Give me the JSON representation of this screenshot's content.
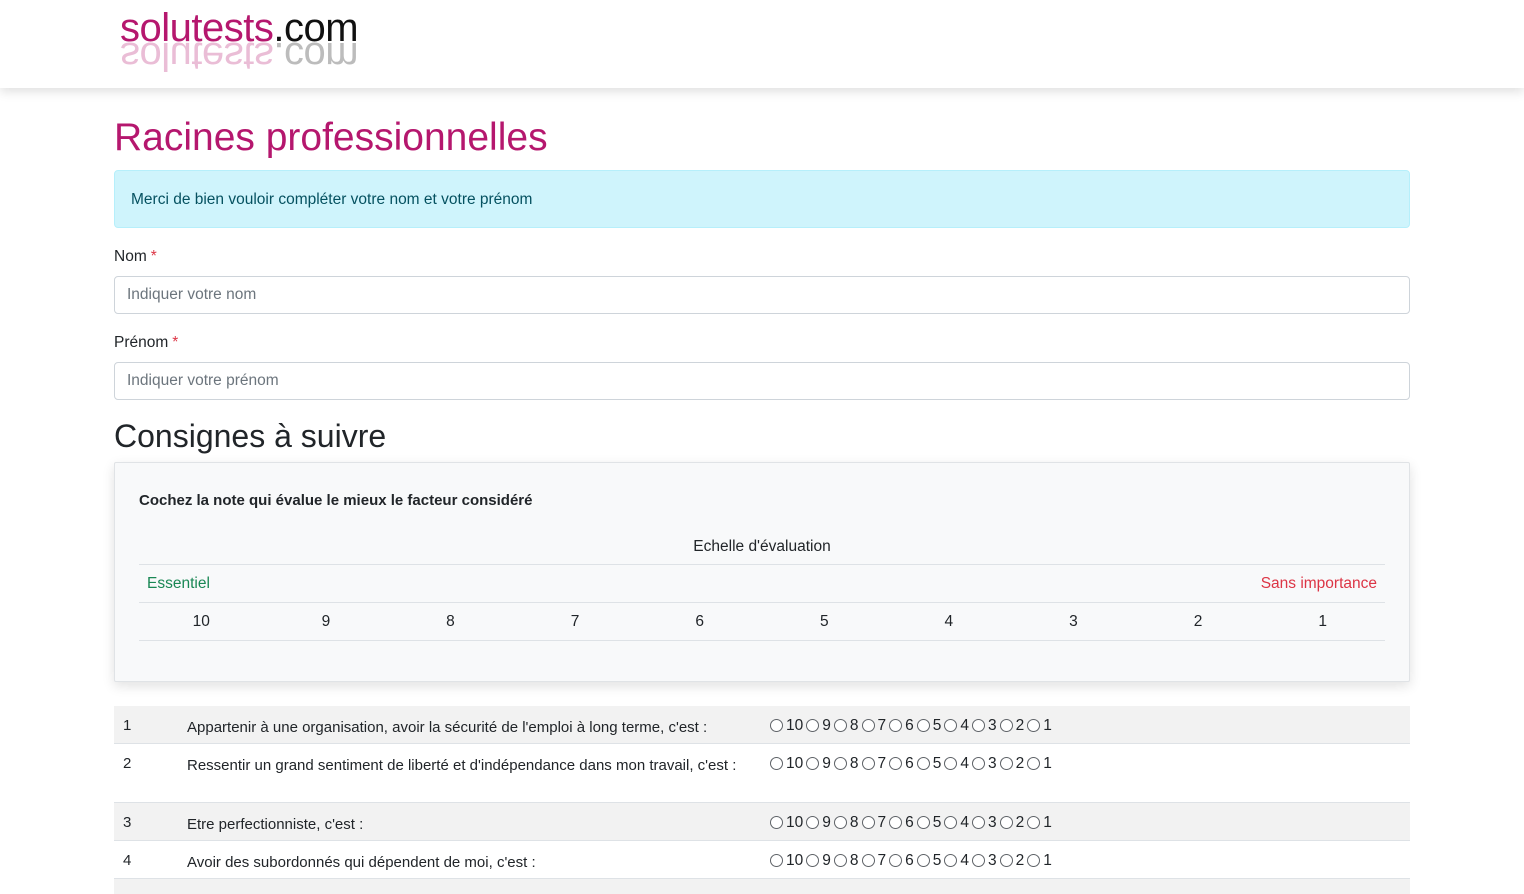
{
  "header": {
    "logo_brand": "solutests",
    "logo_tld": ".com"
  },
  "page": {
    "title": "Racines professionnelles",
    "alert": "Merci de bien vouloir compléter votre nom et votre prénom"
  },
  "form": {
    "nom_label": "Nom",
    "nom_placeholder": "Indiquer votre nom",
    "prenom_label": "Prénom",
    "prenom_placeholder": "Indiquer votre prénom",
    "required_mark": "*"
  },
  "instructions": {
    "title": "Consignes à suivre",
    "intro": "Cochez la note qui évalue le mieux le facteur considéré",
    "scale_caption": "Echelle d'évaluation",
    "scale_left": "Essentiel",
    "scale_right": "Sans importance",
    "scale_values": [
      "10",
      "9",
      "8",
      "7",
      "6",
      "5",
      "4",
      "3",
      "2",
      "1"
    ]
  },
  "colors": {
    "brand": "#b5176e",
    "alert_bg": "#cff4fc",
    "essential": "#198754",
    "unimportant": "#dc3545"
  },
  "options": [
    "10",
    "9",
    "8",
    "7",
    "6",
    "5",
    "4",
    "3",
    "2",
    "1"
  ],
  "questions": [
    {
      "num": "1",
      "text": "Appartenir à une organisation, avoir la sécurité de l'emploi à long terme, c'est :"
    },
    {
      "num": "2",
      "text": "Ressentir un grand sentiment de liberté et d'indépendance dans mon travail, c'est :"
    },
    {
      "num": "3",
      "text": "Etre perfectionniste, c'est :"
    },
    {
      "num": "4",
      "text": "Avoir des subordonnés qui dépendent de moi, c'est :"
    }
  ]
}
